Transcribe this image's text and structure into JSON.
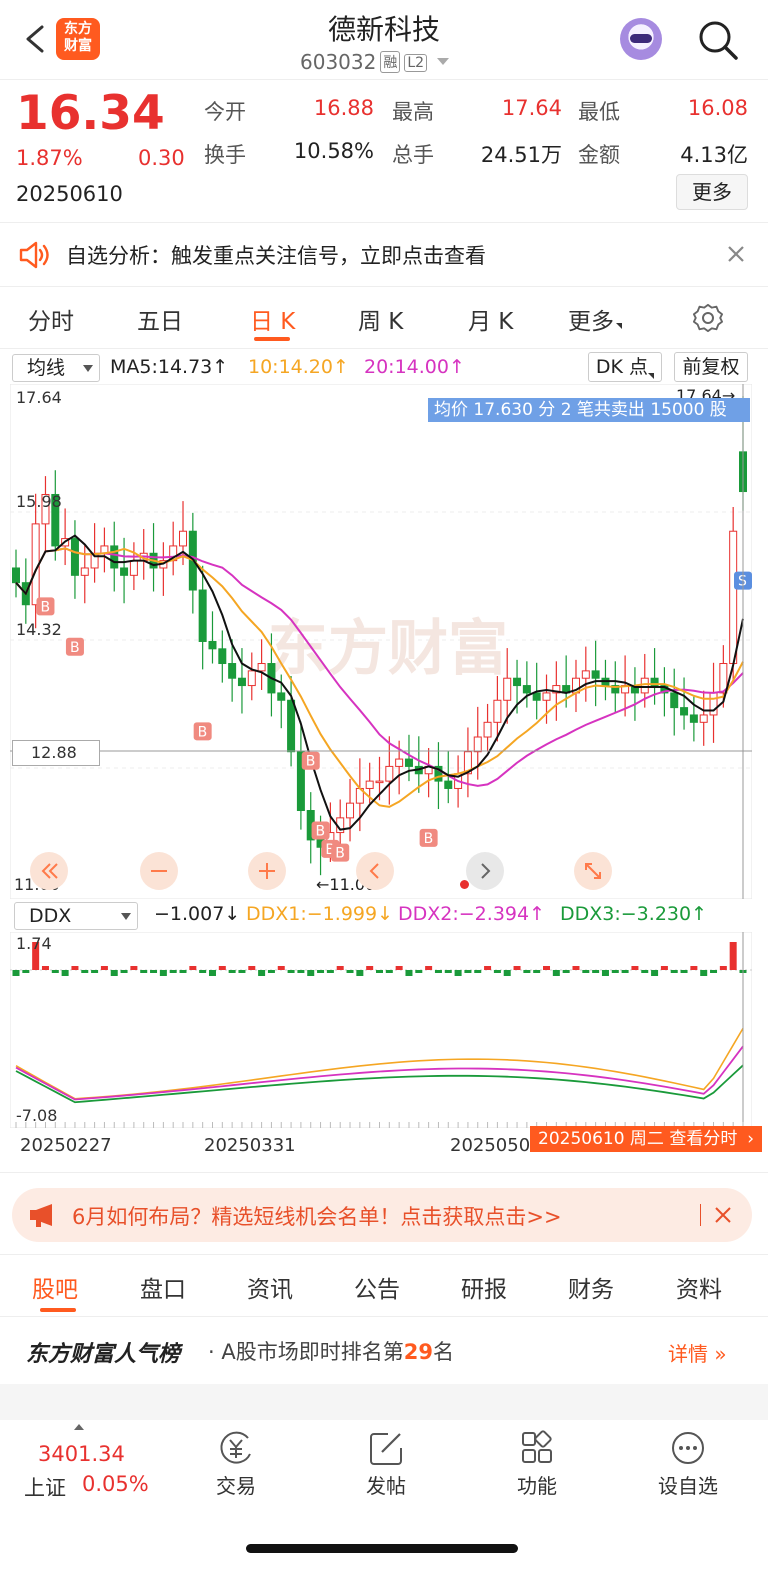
{
  "header": {
    "stock_name": "德新科技",
    "stock_code": "603032",
    "tag_margin": "融",
    "tag_level": "L2",
    "logo_text_line1": "东方",
    "logo_text_line2": "财富"
  },
  "quote": {
    "price": "16.34",
    "change_pct": "1.87%",
    "change": "0.30",
    "date": "20250610",
    "fields": [
      {
        "label": "今开",
        "value": "16.88",
        "color": "#e8312f"
      },
      {
        "label": "最高",
        "value": "17.64",
        "color": "#e8312f"
      },
      {
        "label": "最低",
        "value": "16.08",
        "color": "#e8312f"
      },
      {
        "label": "换手",
        "value": "10.58%",
        "color": "#222222"
      },
      {
        "label": "总手",
        "value": "24.51万",
        "color": "#222222"
      },
      {
        "label": "金额",
        "value": "4.13亿",
        "color": "#222222"
      }
    ],
    "more_label": "更多"
  },
  "analysis_banner": {
    "text": "自选分析：触发重点关注信号，立即点击查看"
  },
  "chart_tabs": {
    "items": [
      "分时",
      "五日",
      "日 K",
      "周 K",
      "月 K",
      "更多"
    ],
    "active": "日 K"
  },
  "kline_toolbar": {
    "indicator": "均线",
    "ma5": "MA5:14.73",
    "ma10": "10:14.20",
    "ma20": "20:14.00",
    "dk_label": "DK 点",
    "adjust_label": "前复权"
  },
  "kline": {
    "y_high": "17.64",
    "y_level2": "15.98",
    "y_level3": "14.32",
    "y_cursor": "12.88",
    "y_low": "11.00",
    "tooltip": "均价 17.630 分 2 笔共卖出 15000 股",
    "high_marker": "17.64",
    "low_marker": "11.00",
    "watermark": "东方财富",
    "buy_marker": "B",
    "sell_marker": "S",
    "colors": {
      "up": "#e8312f",
      "down": "#1a9a3a",
      "ma5": "#000000",
      "ma10": "#f5a623",
      "ma20": "#d633c0"
    }
  },
  "ddx": {
    "indicator": "DDX",
    "value": "−1.007",
    "ddx1": "DDX1:−1.999",
    "ddx2": "DDX2:−2.394",
    "ddx3": "DDX3:−3.230",
    "y_high": "1.74",
    "y_low": "-7.08"
  },
  "x_axis": {
    "labels": [
      "20250227",
      "20250331",
      "20250507"
    ],
    "cursor_tip": "20250610 周二  查看分时"
  },
  "promo": {
    "text": "6月如何布局？精选短线机会名单！点击获取点击>>"
  },
  "bottom_tabs": {
    "items": [
      "股吧",
      "盘口",
      "资讯",
      "公告",
      "研报",
      "财务",
      "资料"
    ],
    "active": "股吧"
  },
  "ranking": {
    "brand": "东方财富人气榜",
    "text_prefix": "· A股市场即时排名第",
    "rank": "29",
    "text_suffix": "名",
    "detail": "详情"
  },
  "bottom_nav": {
    "index_value": "3401.34",
    "index_name": "上证",
    "index_pct": "0.05%",
    "items": [
      {
        "label": "交易",
        "icon": "yen-icon"
      },
      {
        "label": "发帖",
        "icon": "edit-icon"
      },
      {
        "label": "功能",
        "icon": "grid-icon"
      },
      {
        "label": "设自选",
        "icon": "more-dots-icon"
      }
    ]
  }
}
